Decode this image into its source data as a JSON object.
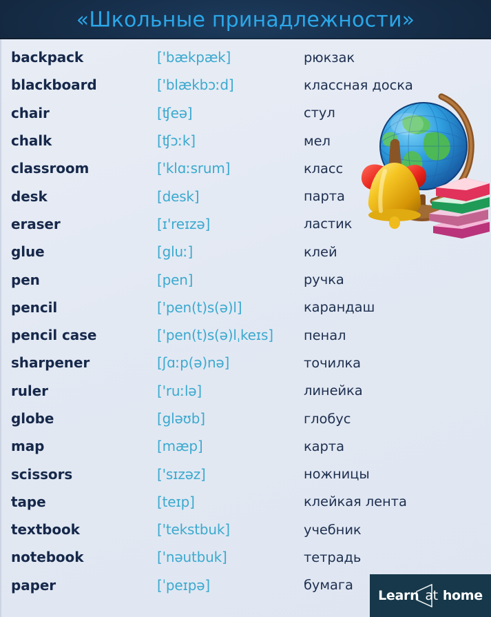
{
  "header": {
    "title": "«Школьные принадлежности»",
    "title_color": "#2ba7e8",
    "background_color": "#17304d"
  },
  "colors": {
    "page_background": "#e6ebf4",
    "word_text": "#16284a",
    "ipa_text": "#3ba9cf",
    "translation_text": "#1e3050",
    "logo_background": "#16384a"
  },
  "table": {
    "rows": [
      {
        "word": "backpack",
        "ipa": "['bækpæk]",
        "ru": "рюкзак"
      },
      {
        "word": "blackboard",
        "ipa": "['blækbɔːd]",
        "ru": "классная доска"
      },
      {
        "word": "chair",
        "ipa": "[ʧeə]",
        "ru": "стул"
      },
      {
        "word": "chalk",
        "ipa": "[ʧɔːk]",
        "ru": "мел"
      },
      {
        "word": "classroom",
        "ipa": "['klɑːsrum]",
        "ru": "класс"
      },
      {
        "word": "desk",
        "ipa": "[desk]",
        "ru": "парта"
      },
      {
        "word": "eraser",
        "ipa": "[ɪ'reɪzə]",
        "ru": "ластик"
      },
      {
        "word": "glue",
        "ipa": "[gluː]",
        "ru": "клей"
      },
      {
        "word": "pen",
        "ipa": "[pen]",
        "ru": "ручка"
      },
      {
        "word": "pencil",
        "ipa": "['pen(t)s(ə)l]",
        "ru": "карандаш"
      },
      {
        "word": "pencil case",
        "ipa": "['pen(t)s(ə)lˌkeɪs]",
        "ru": "пенал"
      },
      {
        "word": "sharpener",
        "ipa": "[ʃɑːp(ə)nə]",
        "ru": "точилка"
      },
      {
        "word": "ruler",
        "ipa": "['ruːlə]",
        "ru": "линейка"
      },
      {
        "word": "globe",
        "ipa": "[gləʊb]",
        "ru": "глобус"
      },
      {
        "word": "map",
        "ipa": "[mæp]",
        "ru": "карта"
      },
      {
        "word": "scissors",
        "ipa": "['sɪzəz]",
        "ru": "ножницы"
      },
      {
        "word": "tape",
        "ipa": "[teɪp]",
        "ru": "клейкая лента"
      },
      {
        "word": "textbook",
        "ipa": "['tekstbuk]",
        "ru": "учебник"
      },
      {
        "word": "notebook",
        "ipa": "['nəutbuk]",
        "ru": "тетрадь"
      },
      {
        "word": "paper",
        "ipa": "[ˈpeɪpə]",
        "ru": "бумага"
      }
    ]
  },
  "illustration": {
    "name": "school-supplies-illustration",
    "elements": [
      "globe",
      "bell",
      "red-bow",
      "books-stack"
    ]
  },
  "logo": {
    "learn": "Learn",
    "at": "at",
    "home": "home"
  }
}
